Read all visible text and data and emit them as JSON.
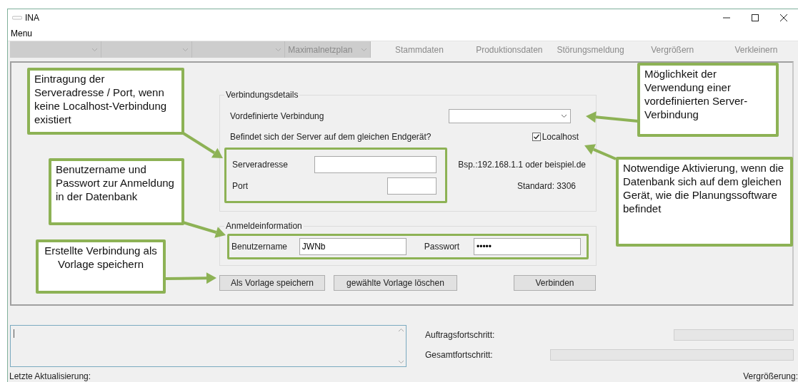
{
  "window": {
    "title": "INA"
  },
  "menu": [
    "Menu"
  ],
  "toolbar": [
    {
      "kind": "combo"
    },
    {
      "kind": "combo"
    },
    {
      "kind": "combo"
    },
    {
      "kind": "combo",
      "value": "Maximalnetzplan"
    },
    {
      "kind": "button",
      "label": "Stammdaten"
    },
    {
      "kind": "button",
      "label": "Produktionsdaten"
    },
    {
      "kind": "button",
      "label": "Störungsmeldung"
    },
    {
      "kind": "button",
      "label": "Vergrößern"
    },
    {
      "kind": "button",
      "label": "Verkleinern"
    }
  ],
  "connection": {
    "legend": "Verbindungsdetails",
    "predefined_label": "Vordefinierte Verbindung",
    "question": "Befindet sich der Server auf dem gleichen Endgerät?",
    "localhost": {
      "label": "Localhost",
      "checked": true
    },
    "server": {
      "label": "Serveradresse",
      "hint": "Bsp.:192.168.1.1 oder beispiel.de"
    },
    "port": {
      "label": "Port",
      "hint": "Standard: 3306"
    }
  },
  "login": {
    "legend": "Anmeldeinformation",
    "username": {
      "label": "Benutzername",
      "value": "JWNb"
    },
    "password": {
      "label": "Passwort",
      "value": "•••••"
    }
  },
  "buttons": [
    "Als Vorlage speichern",
    "gewählte Vorlage löschen",
    "Verbinden"
  ],
  "progress": [
    {
      "label": "Auftragsfortschritt:"
    },
    {
      "label": "Gesamtfortschritt:"
    }
  ],
  "status_bar": {
    "left": "Letzte Aktualisierung:",
    "right": "Vergrößerung:"
  },
  "annotations": [
    "Eintragung der Serveradresse / Port, wenn keine Localhost-Verbindung existiert",
    "Benutzername und Passwort zur Anmeldung in der Datenbank",
    "Erstellte Verbindung als Vorlage speichern",
    "Möglichkeit der Verwendung einer vordefinierten Server-Verbindung",
    "Notwendige Aktivierung, wenn die Datenbank sich auf dem gleichen Gerät, wie die Planungssoftware befindet"
  ]
}
